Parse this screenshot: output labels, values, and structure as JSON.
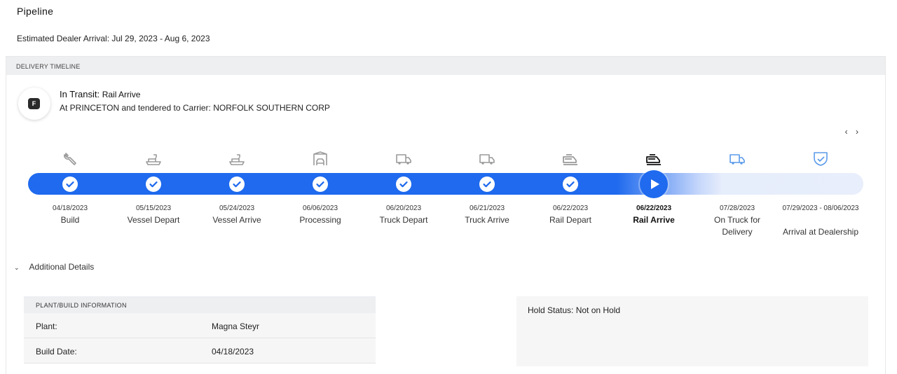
{
  "page": {
    "title": "Pipeline",
    "arrival": "Estimated Dealer Arrival: Jul 29, 2023 - Aug 6, 2023"
  },
  "timeline": {
    "header": "DELIVERY TIMELINE",
    "badge_letter": "F",
    "status_prefix": "In Transit:",
    "status_value": "Rail Arrive",
    "status_detail": "At PRINCETON and tendered to Carrier: NORFOLK SOUTHERN CORP",
    "nav_prev": "‹",
    "nav_next": "›",
    "steps": [
      {
        "date": "04/18/2023",
        "label": "Build",
        "icon": "wrench-icon",
        "state": "done"
      },
      {
        "date": "05/15/2023",
        "label": "Vessel Depart",
        "icon": "ship-icon",
        "state": "done"
      },
      {
        "date": "05/24/2023",
        "label": "Vessel Arrive",
        "icon": "ship-icon",
        "state": "done"
      },
      {
        "date": "06/06/2023",
        "label": "Processing",
        "icon": "warehouse-car-icon",
        "state": "done"
      },
      {
        "date": "06/20/2023",
        "label": "Truck Depart",
        "icon": "truck-icon",
        "state": "done"
      },
      {
        "date": "06/21/2023",
        "label": "Truck Arrive",
        "icon": "truck-icon",
        "state": "done"
      },
      {
        "date": "06/22/2023",
        "label": "Rail Depart",
        "icon": "train-icon",
        "state": "done"
      },
      {
        "date": "06/22/2023",
        "label": "Rail Arrive",
        "icon": "train-icon",
        "state": "current"
      },
      {
        "date": "07/28/2023",
        "label": "On Truck for Delivery",
        "icon": "truck-icon",
        "state": "upcoming"
      },
      {
        "date": "07/29/2023 - 08/06/2023",
        "label": "Arrival at Dealership",
        "icon": "shield-check-icon",
        "state": "upcoming"
      }
    ]
  },
  "details": {
    "toggle_label": "Additional Details",
    "plant": {
      "header": "PLANT/BUILD INFORMATION",
      "rows": [
        {
          "key": "Plant:",
          "value": "Magna Steyr"
        },
        {
          "key": "Build Date:",
          "value": "04/18/2023"
        }
      ]
    },
    "hold_status": "Hold Status: Not on Hold"
  },
  "colors": {
    "progress": "#1f6aee",
    "track_remaining": "#e6edfb",
    "done_icon": "#9a9a9a",
    "current_icon": "#111111",
    "upcoming_icon": "#5b9be9"
  }
}
